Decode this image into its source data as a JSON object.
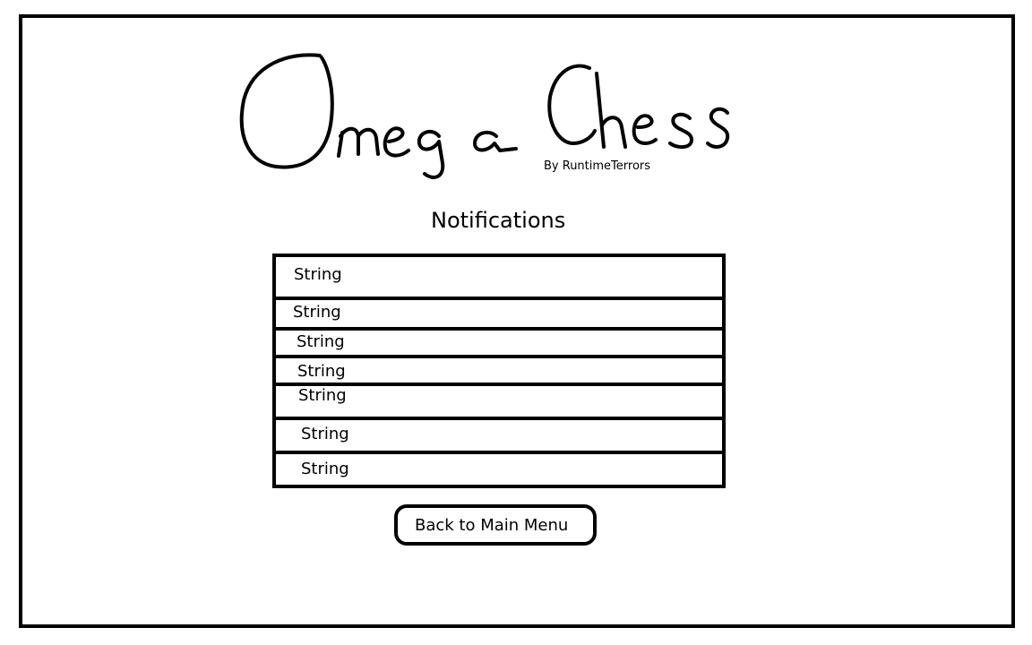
{
  "app": {
    "logo_text": "Omega Chess",
    "byline": "By RuntimeTerrors"
  },
  "page": {
    "title": "Notifications"
  },
  "notifications": [
    {
      "text": "String"
    },
    {
      "text": "String"
    },
    {
      "text": "String"
    },
    {
      "text": "String"
    },
    {
      "text": "String"
    },
    {
      "text": "String"
    },
    {
      "text": "String"
    }
  ],
  "actions": {
    "back_label": "Back to Main Menu"
  }
}
